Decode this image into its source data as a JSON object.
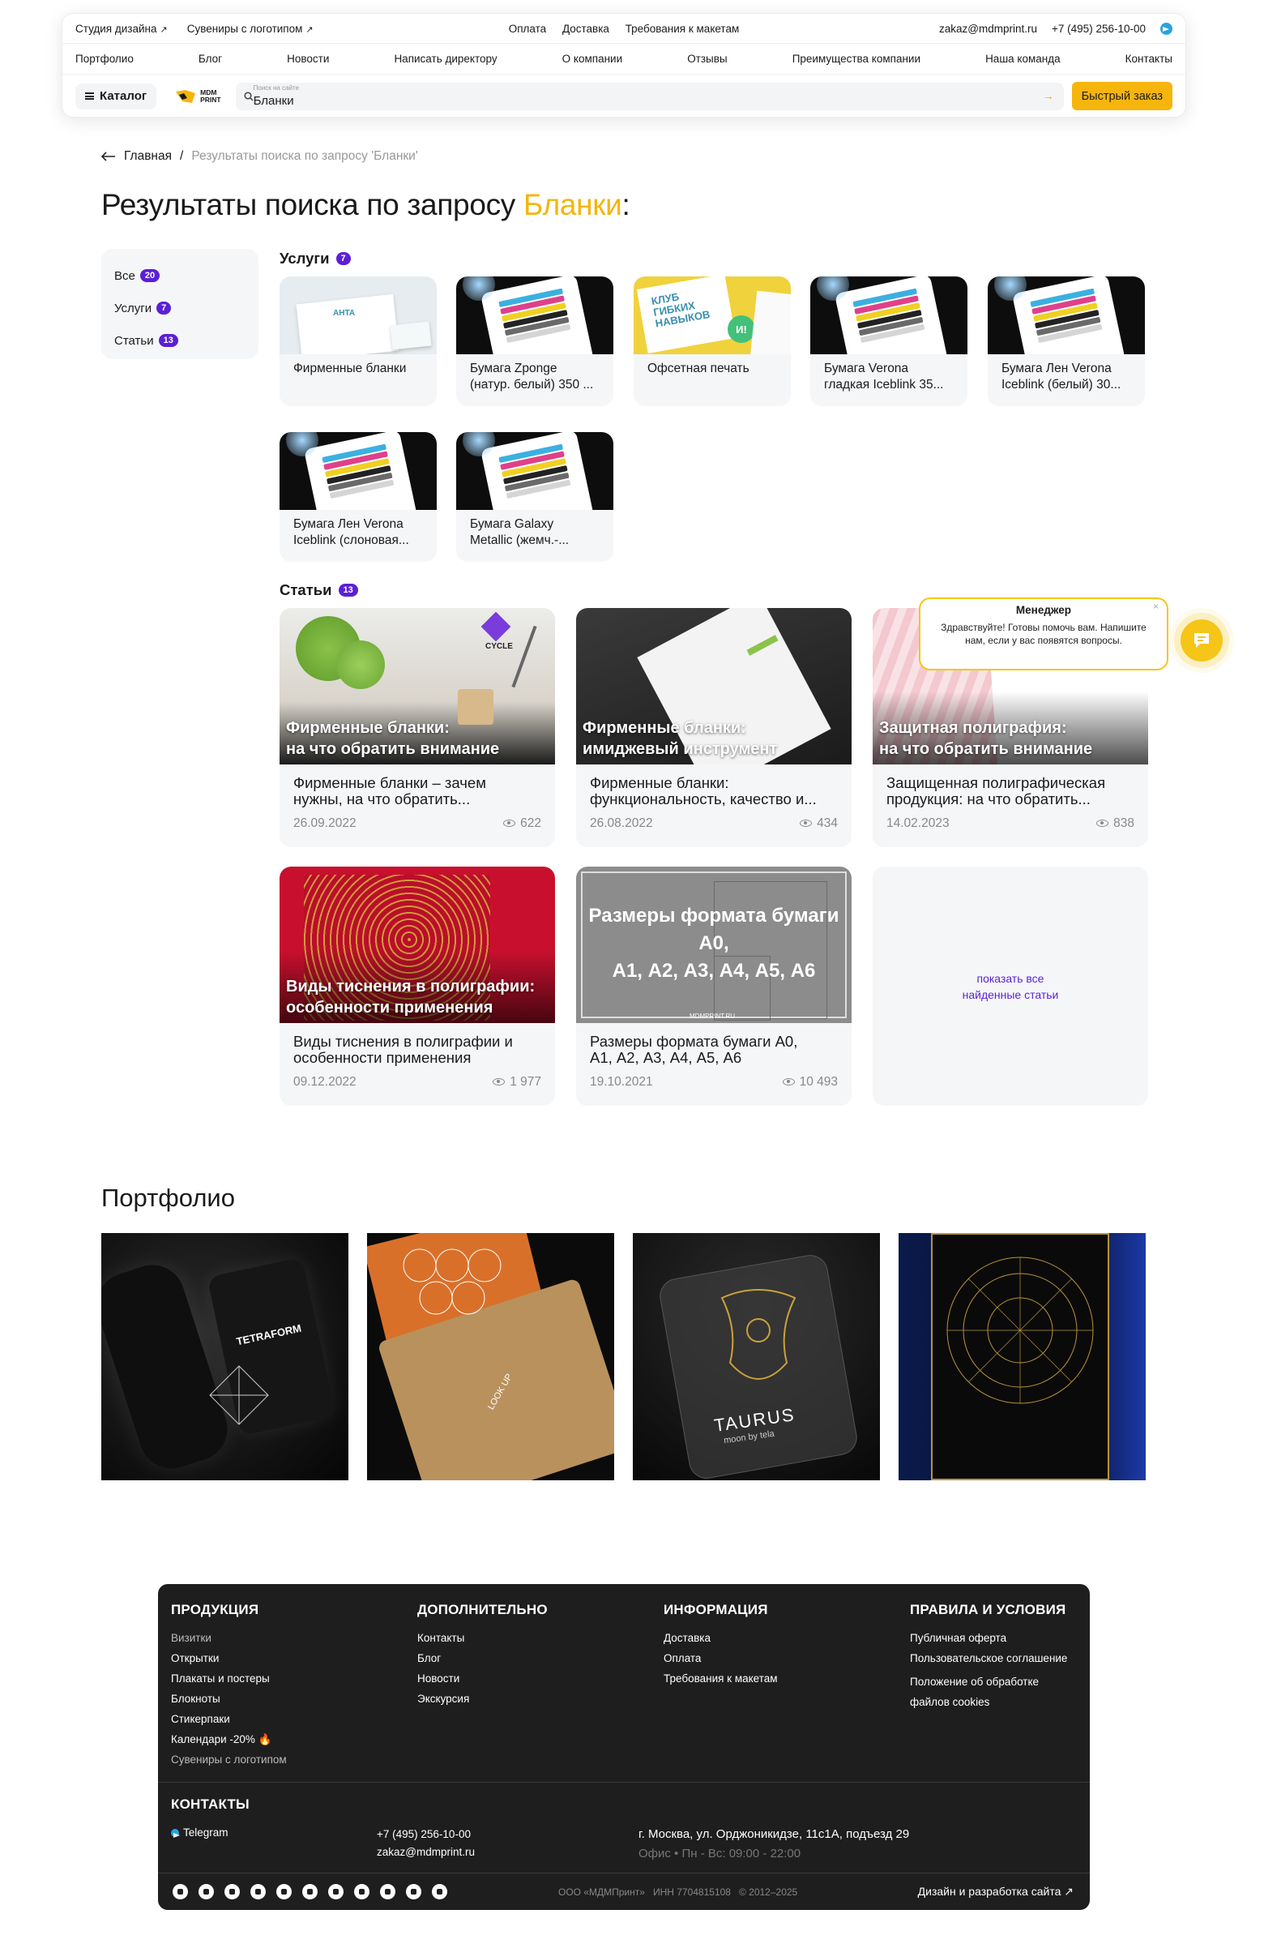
{
  "header": {
    "top_left": [
      "Студия дизайна",
      "Сувениры с логотипом"
    ],
    "top_center": [
      "Оплата",
      "Доставка",
      "Требования к макетам"
    ],
    "email": "zakaz@mdmprint.ru",
    "phone": "+7 (495) 256-10-00",
    "nav": [
      "Портфолио",
      "Блог",
      "Новости",
      "Написать директору",
      "О компании",
      "Отзывы",
      "Преимущества компании",
      "Наша команда",
      "Контакты"
    ],
    "catalog_label": "Каталог",
    "logo_text_1": "MDM",
    "logo_text_2": "PRINT",
    "search_label": "Поиск на сайте",
    "search_value": "Бланки",
    "fast_order": "Быстрый заказ",
    "arrow": "↗",
    "go_arrow": "→"
  },
  "breadcrumb": {
    "home": "Главная",
    "sep": "/",
    "current": "Результаты поиска по запросу 'Бланки'"
  },
  "title": {
    "prefix": "Результаты поиска по запросу",
    "query": "Бланки",
    "suffix": ":"
  },
  "filters": [
    {
      "label": "Все",
      "count": "20"
    },
    {
      "label": "Услуги",
      "count": "7"
    },
    {
      "label": "Статьи",
      "count": "13"
    }
  ],
  "services": {
    "heading": "Услуги",
    "count": "7",
    "items": [
      {
        "l1": "Фирменные бланки",
        "l2": ""
      },
      {
        "l1": "Бумага Zponge",
        "l2": "(натур. белый) 350 ..."
      },
      {
        "l1": "Офсетная печать",
        "l2": ""
      },
      {
        "l1": "Бумага Verona",
        "l2": "гладкая Iceblink 35..."
      },
      {
        "l1": "Бумага Лен Verona",
        "l2": "Iceblink (белый) 30..."
      },
      {
        "l1": "Бумага Лен Verona",
        "l2": "Iceblink (слоновая..."
      },
      {
        "l1": "Бумага Galaxy",
        "l2": "Metallic (жемч.-..."
      }
    ],
    "promo_text_1": "КЛУБ",
    "promo_text_2": "ГИБКИХ",
    "promo_text_3": "НАВЫКОВ",
    "promo_badge": "И!",
    "anta_logo": "АНТА"
  },
  "articles": {
    "heading": "Статьи",
    "count": "13",
    "items": [
      {
        "ov1": "Фирменные бланки:",
        "ov2": "на что обратить внимание",
        "t1": "Фирменные бланки – зачем",
        "t2": "нужны, на что обратить...",
        "date": "26.09.2022",
        "views": "622",
        "tag": "CYCLE"
      },
      {
        "ov1": "Фирменные бланки:",
        "ov2": "имиджевый инструмент",
        "t1": "Фирменные бланки:",
        "t2": "функциональность, качество и...",
        "date": "26.08.2022",
        "views": "434"
      },
      {
        "ov1": "Защитная полиграфия:",
        "ov2": "на что обратить внимание",
        "t1": "Защищенная полиграфическая",
        "t2": "продукция: на что обратить...",
        "date": "14.02.2023",
        "views": "838"
      },
      {
        "ov1": "Виды тиснения в полиграфии:",
        "ov2": "особенности применения",
        "t1": "Виды тиснения в полиграфии и",
        "t2": "особенности применения",
        "date": "09.12.2022",
        "views": "1 977"
      },
      {
        "ov1": "Размеры формата бумаги А0,",
        "ov2": "А1, А2, А3, А4, А5, А6",
        "t1": "Размеры формата бумаги А0,",
        "t2": "А1, А2, А3, А4, А5, А6",
        "date": "19.10.2021",
        "views": "10 493",
        "site": "MDMPRINT.RU"
      }
    ],
    "show_all_1": "показать все",
    "show_all_2": "найденные статьи"
  },
  "chat": {
    "title": "Менеджер",
    "message": "Здравствуйте! Готовы помочь вам. Напишите нам, если у вас появятся вопросы.",
    "close": "×"
  },
  "portfolio": {
    "heading": "Портфолио",
    "brand1": "TETRAFORM",
    "brand3": "TAURUS",
    "brand3_sub": "moon by tela",
    "brand2": "LOOK UP"
  },
  "footer": {
    "cols": [
      {
        "title": "Продукция",
        "items": [
          "Визитки",
          "Открытки",
          "Плакаты и постеры",
          "Блокноты",
          "Стикерпаки",
          "Календари -20% 🔥",
          "Сувениры с логотипом"
        ]
      },
      {
        "title": "Дополнительно",
        "items": [
          "Контакты",
          "Блог",
          "Новости",
          "Экскурсия"
        ]
      },
      {
        "title": "Информация",
        "items": [
          "Доставка",
          "Оплата",
          "Требования к макетам"
        ]
      },
      {
        "title": "Правила и условия",
        "items": [
          "Публичная оферта",
          "Пользовательское соглашение",
          "Положение об обработке",
          "файлов cookies"
        ]
      }
    ],
    "contacts_title": "Контакты",
    "telegram": "Telegram",
    "phone": "+7 (495) 256-10-00",
    "email": "zakaz@mdmprint.ru",
    "address": "г. Москва, ул. Орджоникидзе, 11с1А, подъезд 29",
    "hours": "Офис • Пн - Вс: 09:00 - 22:00",
    "company": "ООО «МДМПринт»",
    "inn": "ИНН 7704815108",
    "years": "© 2012–2025",
    "dev": "Дизайн и разработка сайта ↗"
  },
  "colors": {
    "accent": "#f5b50c",
    "badge": "#5b1fd6",
    "footer_bg": "#1e1e1e"
  }
}
